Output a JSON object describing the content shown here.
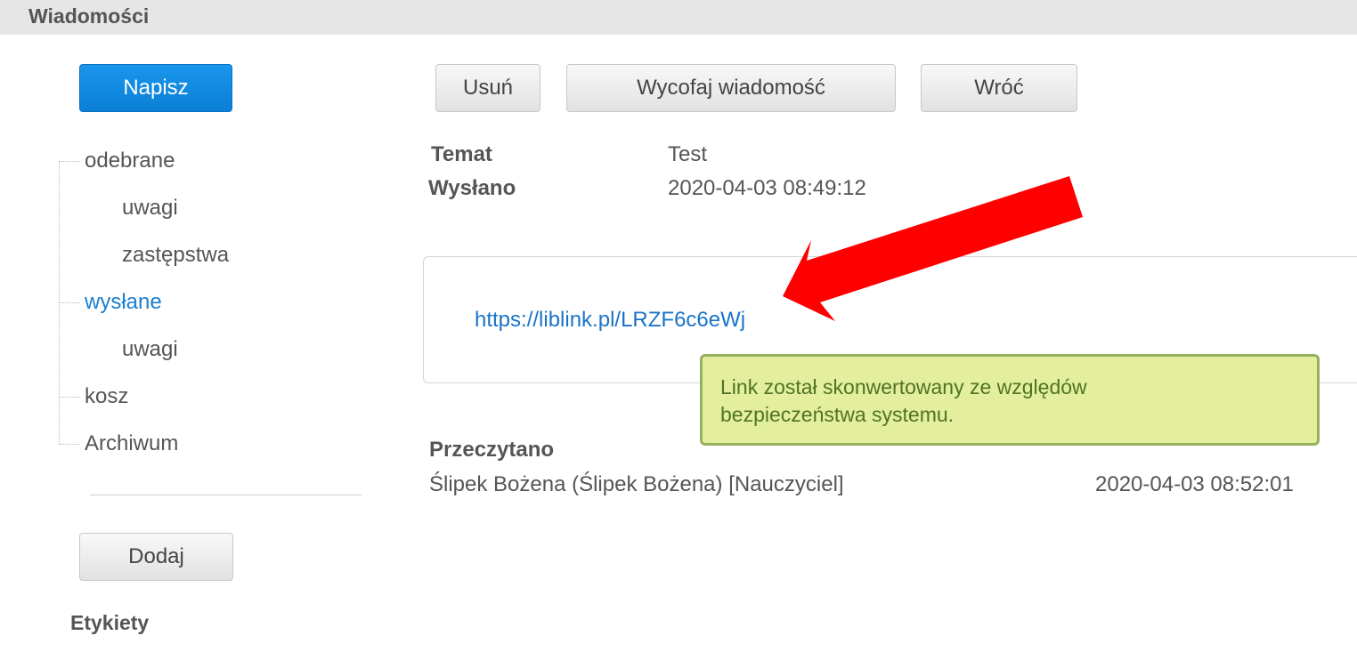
{
  "header": {
    "title": "Wiadomości"
  },
  "sidebar": {
    "compose_label": "Napisz",
    "folders": [
      {
        "label": "odebrane"
      },
      {
        "label": "uwagi"
      },
      {
        "label": "zastępstwa"
      },
      {
        "label": "wysłane"
      },
      {
        "label": "uwagi"
      },
      {
        "label": "kosz"
      },
      {
        "label": "Archiwum"
      }
    ],
    "add_label": "Dodaj",
    "labels_heading": "Etykiety"
  },
  "toolbar": {
    "delete_label": "Usuń",
    "recall_label": "Wycofaj wiadomość",
    "back_label": "Wróć"
  },
  "message": {
    "subject_label": "Temat",
    "subject_value": "Test",
    "sent_label": "Wysłano",
    "sent_value": "2020-04-03 08:49:12",
    "body_link": "https://liblink.pl/LRZF6c6eWj",
    "tooltip_line1": "Link został skonwertowany ze względów",
    "tooltip_line2": "bezpieczeństwa systemu."
  },
  "read_receipts": {
    "heading": "Przeczytano",
    "entries": [
      {
        "name": "Ślipek Bożena (Ślipek Bożena) [Nauczyciel]",
        "time": "2020-04-03 08:52:01"
      }
    ]
  },
  "colors": {
    "accent": "#0a7fd6",
    "link": "#1a73c8",
    "tooltip_bg": "#e4ef9e",
    "tooltip_border": "#95b05e",
    "annotation_arrow": "#ff0000"
  }
}
